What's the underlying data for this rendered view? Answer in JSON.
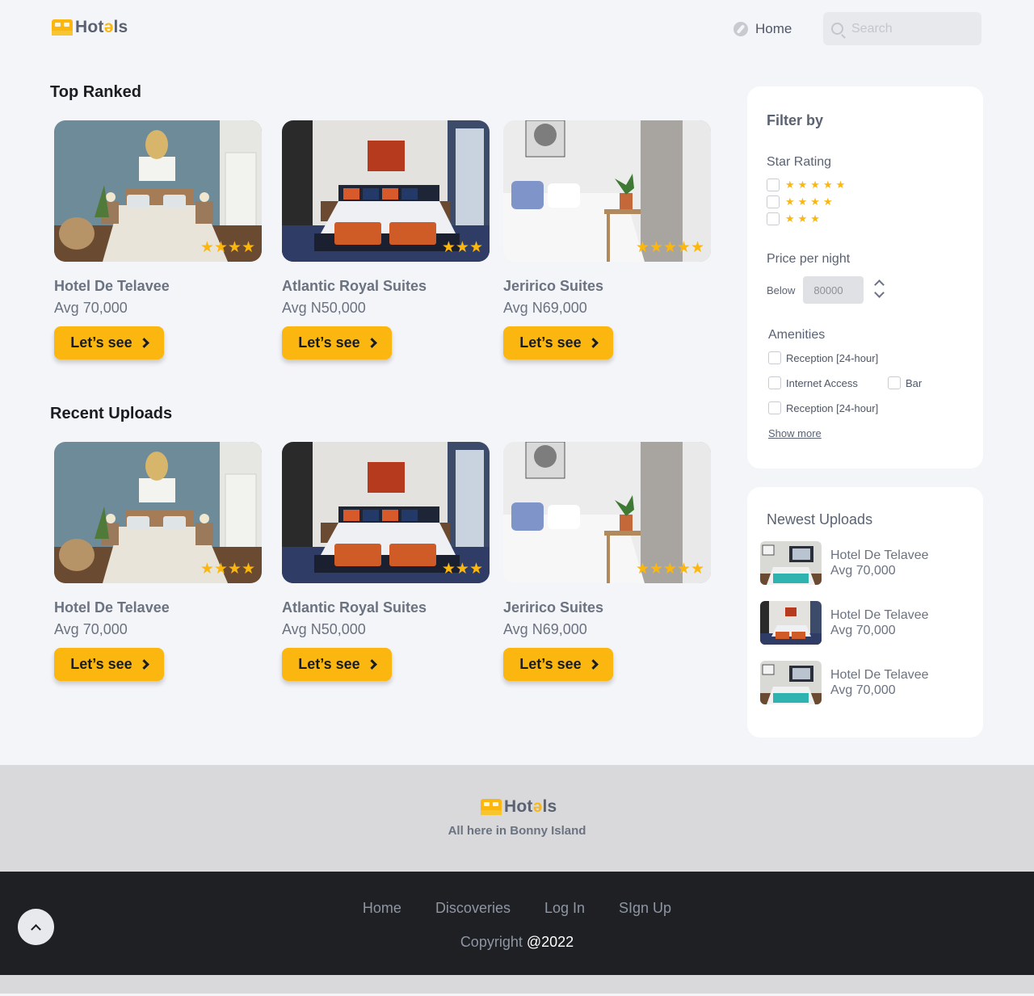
{
  "header": {
    "logo_prefix": "Hot",
    "logo_e": "ə",
    "logo_suffix": "ls",
    "nav_home": "Home",
    "search_placeholder": "Search"
  },
  "top_ranked": {
    "title": "Top Ranked",
    "cards": [
      {
        "name": "Hotel De Telavee",
        "price": "Avg 70,000",
        "stars": "★★★★",
        "button": "Let’s see"
      },
      {
        "name": "Atlantic Royal Suites",
        "price": "Avg N50,000",
        "stars": "★★★",
        "button": "Let’s see"
      },
      {
        "name": "Jeririco Suites",
        "price": "Avg N69,000",
        "stars": "★★★★★",
        "button": "Let’s see"
      }
    ]
  },
  "recent_uploads": {
    "title": "Recent Uploads",
    "cards": [
      {
        "name": "Hotel De Telavee",
        "price": "Avg 70,000",
        "stars": "★★★★",
        "button": "Let’s see"
      },
      {
        "name": "Atlantic Royal Suites",
        "price": "Avg N50,000",
        "stars": "★★★",
        "button": "Let’s see"
      },
      {
        "name": "Jeririco Suites",
        "price": "Avg N69,000",
        "stars": "★★★★★",
        "button": "Let’s see"
      }
    ]
  },
  "filter": {
    "title": "Filter by",
    "star_rating_label": "Star Rating",
    "star_options": [
      "★★★★★",
      "★★★★",
      "★★★"
    ],
    "price_label": "Price per night",
    "price_prefix": "Below",
    "price_value": "80000",
    "amenities_label": "Amenities",
    "amenities": [
      "Reception [24-hour]",
      "Internet Access",
      "Bar",
      "Reception [24-hour]"
    ],
    "show_more": "Show more"
  },
  "newest": {
    "title": "Newest Uploads",
    "items": [
      {
        "name": "Hotel De Telavee",
        "price": "Avg 70,000"
      },
      {
        "name": "Hotel De Telavee",
        "price": "Avg 70,000"
      },
      {
        "name": "Hotel De Telavee",
        "price": "Avg 70,000"
      }
    ]
  },
  "footer": {
    "tagline": "All here in Bonny Island",
    "links": [
      "Home",
      "Discoveries",
      "Log In",
      "SIgn Up"
    ],
    "copyright_prefix": "Copyright ",
    "copyright_year": "@2022"
  },
  "colors": {
    "accent": "#fbb70f",
    "dark_footer": "#1f2023",
    "page_bg": "#f4f5f9"
  }
}
